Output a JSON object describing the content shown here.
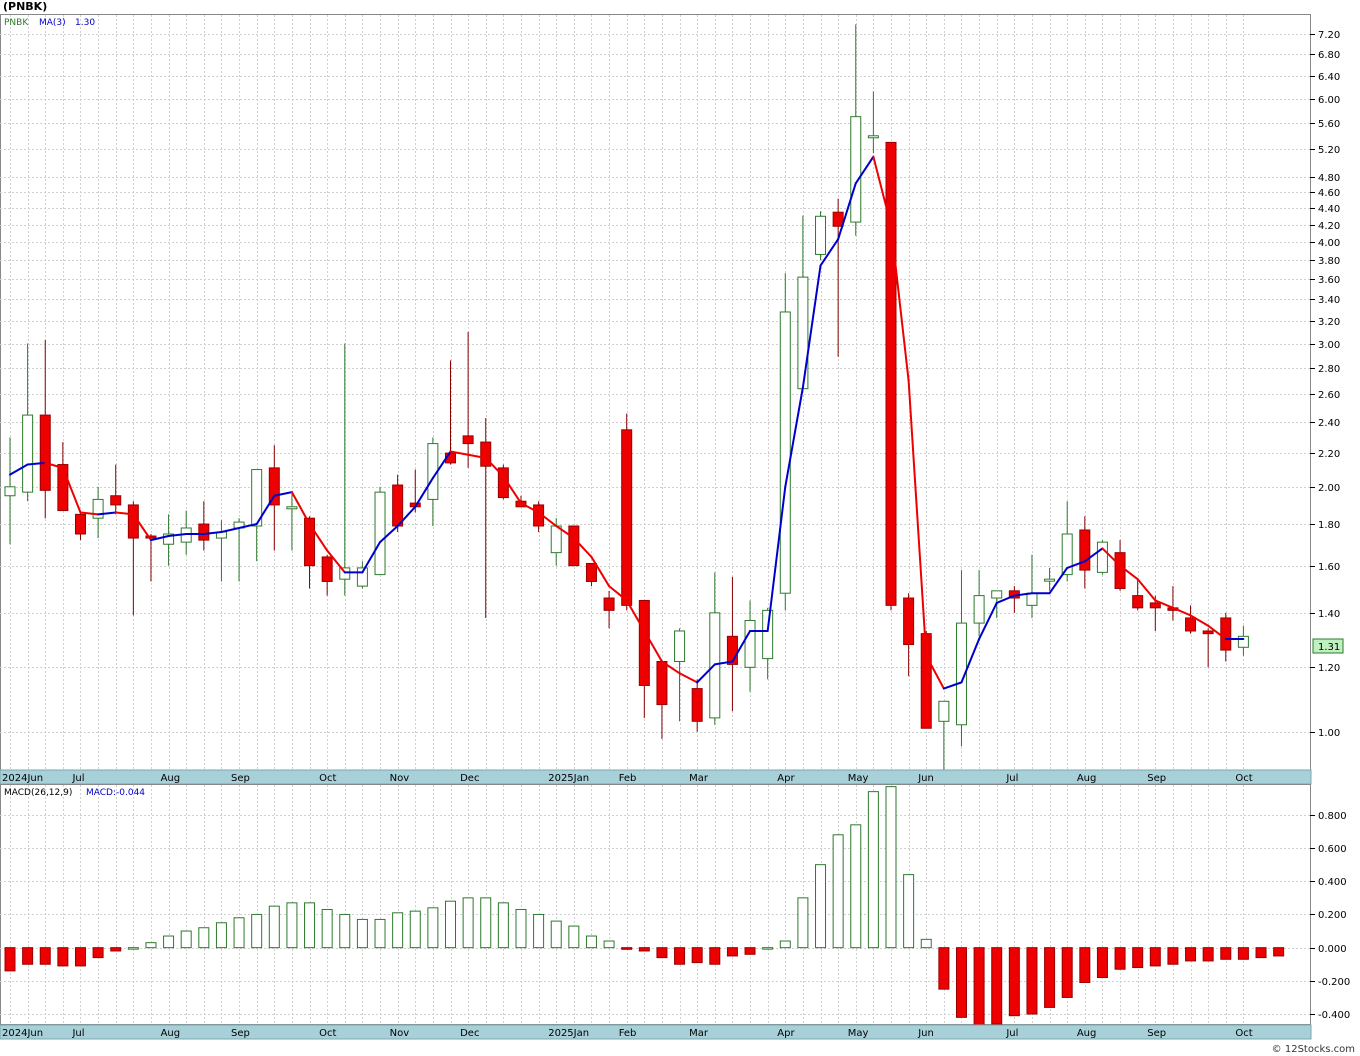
{
  "header": {
    "symbol_title": "(PNBK)",
    "legend_symbol": "PNBK",
    "legend_ma_label": "MA(3)",
    "legend_ma_value": "1.30",
    "macd_label": "MACD(26,12,9)",
    "macd_value_label": "MACD:-0.044",
    "last_price_label": "1.31",
    "footer_credit": "© 12Stocks.com"
  },
  "colors": {
    "up_candle": "#2d7a2d",
    "down_candle": "#ee0000",
    "ma_rising": "#0000cc",
    "ma_falling": "#ee0000",
    "grid": "#d0d0d0",
    "axis_band": "#a8d0d8",
    "last_price_box": "#bff0bf"
  },
  "chart_data": [
    {
      "type": "candlestick",
      "title": "(PNBK)",
      "scale": "log",
      "ylim": [
        0.9,
        7.6
      ],
      "y_ticks": [
        1.0,
        1.2,
        1.4,
        1.6,
        1.8,
        2.0,
        2.2,
        2.4,
        2.6,
        2.8,
        3.0,
        3.2,
        3.4,
        3.6,
        3.8,
        4.0,
        4.2,
        4.4,
        4.6,
        4.8,
        5.2,
        5.6,
        6.0,
        6.4,
        6.8,
        7.2
      ],
      "y_tick_labels": [
        "1.00",
        "1.20",
        "1.40",
        "1.60",
        "1.80",
        "2.00",
        "2.20",
        "2.40",
        "2.60",
        "2.80",
        "3.00",
        "3.20",
        "3.40",
        "3.60",
        "3.80",
        "4.00",
        "4.20",
        "4.40",
        "4.60",
        "4.80",
        "5.20",
        "5.60",
        "6.00",
        "6.40",
        "6.80",
        "7.20"
      ],
      "x_labels": [
        "2024Jun",
        "Jul",
        "Aug",
        "Sep",
        "Oct",
        "Nov",
        "Dec",
        "2025Jan",
        "Feb",
        "Mar",
        "Apr",
        "May",
        "Jun",
        "Jul",
        "Aug",
        "Sep",
        "Oct"
      ],
      "x_label_weeks": [
        0,
        4,
        9,
        13,
        18,
        22,
        26,
        31,
        35,
        39,
        44,
        48,
        52,
        57,
        61,
        65,
        70
      ],
      "grid": true,
      "candles": [
        {
          "o": 1.95,
          "h": 2.3,
          "l": 1.7,
          "c": 2.0
        },
        {
          "o": 1.97,
          "h": 3.0,
          "l": 1.92,
          "c": 2.45
        },
        {
          "o": 2.45,
          "h": 3.03,
          "l": 1.83,
          "c": 1.98
        },
        {
          "o": 2.13,
          "h": 2.27,
          "l": 1.87,
          "c": 1.87
        },
        {
          "o": 1.85,
          "h": 1.87,
          "l": 1.72,
          "c": 1.75
        },
        {
          "o": 1.83,
          "h": 2.0,
          "l": 1.73,
          "c": 1.93
        },
        {
          "o": 1.95,
          "h": 2.13,
          "l": 1.85,
          "c": 1.9
        },
        {
          "o": 1.9,
          "h": 1.92,
          "l": 1.39,
          "c": 1.73
        },
        {
          "o": 1.74,
          "h": 1.75,
          "l": 1.53,
          "c": 1.73
        },
        {
          "o": 1.7,
          "h": 1.85,
          "l": 1.6,
          "c": 1.75
        },
        {
          "o": 1.71,
          "h": 1.87,
          "l": 1.65,
          "c": 1.78
        },
        {
          "o": 1.8,
          "h": 1.92,
          "l": 1.67,
          "c": 1.72
        },
        {
          "o": 1.73,
          "h": 1.82,
          "l": 1.53,
          "c": 1.76
        },
        {
          "o": 1.78,
          "h": 1.83,
          "l": 1.53,
          "c": 1.81
        },
        {
          "o": 1.79,
          "h": 2.1,
          "l": 1.62,
          "c": 2.1
        },
        {
          "o": 2.11,
          "h": 2.25,
          "l": 1.67,
          "c": 1.9
        },
        {
          "o": 1.89,
          "h": 1.96,
          "l": 1.67,
          "c": 1.89
        },
        {
          "o": 1.83,
          "h": 1.84,
          "l": 1.5,
          "c": 1.6
        },
        {
          "o": 1.64,
          "h": 1.65,
          "l": 1.47,
          "c": 1.53
        },
        {
          "o": 1.54,
          "h": 3.0,
          "l": 1.47,
          "c": 1.59
        },
        {
          "o": 1.51,
          "h": 1.62,
          "l": 1.5,
          "c": 1.59
        },
        {
          "o": 1.56,
          "h": 2.0,
          "l": 1.56,
          "c": 1.97
        },
        {
          "o": 2.01,
          "h": 2.07,
          "l": 1.76,
          "c": 1.79
        },
        {
          "o": 1.91,
          "h": 2.1,
          "l": 1.86,
          "c": 1.89
        },
        {
          "o": 1.93,
          "h": 2.3,
          "l": 1.79,
          "c": 2.26
        },
        {
          "o": 2.2,
          "h": 2.86,
          "l": 2.13,
          "c": 2.14
        },
        {
          "o": 2.31,
          "h": 3.1,
          "l": 2.11,
          "c": 2.26
        },
        {
          "o": 2.27,
          "h": 2.43,
          "l": 1.38,
          "c": 2.12
        },
        {
          "o": 2.11,
          "h": 2.13,
          "l": 1.93,
          "c": 1.94
        },
        {
          "o": 1.92,
          "h": 1.95,
          "l": 1.91,
          "c": 1.89
        },
        {
          "o": 1.9,
          "h": 1.92,
          "l": 1.76,
          "c": 1.79
        },
        {
          "o": 1.66,
          "h": 1.83,
          "l": 1.6,
          "c": 1.79
        },
        {
          "o": 1.79,
          "h": 1.79,
          "l": 1.6,
          "c": 1.6
        },
        {
          "o": 1.61,
          "h": 1.61,
          "l": 1.51,
          "c": 1.53
        },
        {
          "o": 1.46,
          "h": 1.49,
          "l": 1.34,
          "c": 1.41
        },
        {
          "o": 2.35,
          "h": 2.46,
          "l": 1.41,
          "c": 1.43
        },
        {
          "o": 1.45,
          "h": 1.45,
          "l": 1.04,
          "c": 1.14
        },
        {
          "o": 1.22,
          "h": 1.22,
          "l": 0.98,
          "c": 1.08
        },
        {
          "o": 1.22,
          "h": 1.34,
          "l": 1.03,
          "c": 1.33
        },
        {
          "o": 1.13,
          "h": 1.16,
          "l": 1.0,
          "c": 1.03
        },
        {
          "o": 1.04,
          "h": 1.57,
          "l": 1.02,
          "c": 1.4
        },
        {
          "o": 1.31,
          "h": 1.55,
          "l": 1.06,
          "c": 1.21
        },
        {
          "o": 1.2,
          "h": 1.45,
          "l": 1.12,
          "c": 1.37
        },
        {
          "o": 1.23,
          "h": 1.42,
          "l": 1.16,
          "c": 1.41
        },
        {
          "o": 1.48,
          "h": 3.66,
          "l": 1.41,
          "c": 3.28
        },
        {
          "o": 2.64,
          "h": 4.31,
          "l": 2.64,
          "c": 3.62
        },
        {
          "o": 3.86,
          "h": 4.36,
          "l": 3.8,
          "c": 4.3
        },
        {
          "o": 4.35,
          "h": 4.52,
          "l": 2.89,
          "c": 4.18
        },
        {
          "o": 4.23,
          "h": 7.4,
          "l": 4.07,
          "c": 5.7
        },
        {
          "o": 5.4,
          "h": 6.12,
          "l": 5.14,
          "c": 5.4
        },
        {
          "o": 5.3,
          "h": 5.3,
          "l": 1.41,
          "c": 1.43
        },
        {
          "o": 1.46,
          "h": 1.48,
          "l": 1.17,
          "c": 1.28
        },
        {
          "o": 1.32,
          "h": 1.33,
          "l": 1.01,
          "c": 1.01
        },
        {
          "o": 1.03,
          "h": 1.08,
          "l": 0.89,
          "c": 1.09
        },
        {
          "o": 1.02,
          "h": 1.58,
          "l": 0.96,
          "c": 1.36
        },
        {
          "o": 1.36,
          "h": 1.58,
          "l": 1.31,
          "c": 1.47
        },
        {
          "o": 1.46,
          "h": 1.49,
          "l": 1.38,
          "c": 1.49
        },
        {
          "o": 1.49,
          "h": 1.51,
          "l": 1.4,
          "c": 1.46
        },
        {
          "o": 1.43,
          "h": 1.65,
          "l": 1.38,
          "c": 1.48
        },
        {
          "o": 1.54,
          "h": 1.59,
          "l": 1.49,
          "c": 1.54
        },
        {
          "o": 1.56,
          "h": 1.92,
          "l": 1.53,
          "c": 1.75
        },
        {
          "o": 1.77,
          "h": 1.84,
          "l": 1.5,
          "c": 1.58
        },
        {
          "o": 1.57,
          "h": 1.72,
          "l": 1.56,
          "c": 1.71
        },
        {
          "o": 1.66,
          "h": 1.72,
          "l": 1.49,
          "c": 1.5
        },
        {
          "o": 1.47,
          "h": 1.54,
          "l": 1.41,
          "c": 1.42
        },
        {
          "o": 1.44,
          "h": 1.47,
          "l": 1.33,
          "c": 1.42
        },
        {
          "o": 1.42,
          "h": 1.51,
          "l": 1.37,
          "c": 1.41
        },
        {
          "o": 1.38,
          "h": 1.43,
          "l": 1.32,
          "c": 1.33
        },
        {
          "o": 1.33,
          "h": 1.34,
          "l": 1.2,
          "c": 1.32
        },
        {
          "o": 1.38,
          "h": 1.4,
          "l": 1.22,
          "c": 1.26
        },
        {
          "o": 1.27,
          "h": 1.35,
          "l": 1.24,
          "c": 1.31
        }
      ],
      "ma3": [
        2.07,
        2.13,
        2.14,
        2.11,
        1.86,
        1.85,
        1.86,
        1.85,
        1.72,
        1.74,
        1.75,
        1.75,
        1.76,
        1.78,
        1.8,
        1.95,
        1.97,
        1.8,
        1.67,
        1.57,
        1.57,
        1.71,
        1.79,
        1.89,
        2.05,
        2.21,
        2.19,
        2.17,
        2.06,
        1.91,
        1.86,
        1.79,
        1.73,
        1.64,
        1.51,
        1.45,
        1.33,
        1.22,
        1.18,
        1.15,
        1.21,
        1.22,
        1.33,
        1.33,
        2.0,
        2.65,
        3.74,
        4.03,
        4.72,
        5.09,
        4.19,
        2.7,
        1.24,
        1.13,
        1.15,
        1.3,
        1.44,
        1.47,
        1.48,
        1.48,
        1.59,
        1.62,
        1.68,
        1.6,
        1.54,
        1.45,
        1.42,
        1.39,
        1.35,
        1.3,
        1.3
      ],
      "last_price": 1.31
    },
    {
      "type": "bar",
      "title": "MACD(26,12,9)",
      "ylim": [
        -0.46,
        0.98
      ],
      "y_ticks": [
        -0.4,
        -0.2,
        0.0,
        0.2,
        0.4,
        0.6,
        0.8
      ],
      "y_tick_labels": [
        "-0.400",
        "-0.200",
        "0.000",
        "0.200",
        "0.400",
        "0.600",
        "0.800"
      ],
      "x_labels": [
        "2024Jun",
        "Jul",
        "Aug",
        "Sep",
        "Oct",
        "Nov",
        "Dec",
        "2025Jan",
        "Feb",
        "Mar",
        "Apr",
        "May",
        "Jun",
        "Jul",
        "Aug",
        "Sep",
        "Oct"
      ],
      "values": [
        -0.14,
        -0.1,
        -0.1,
        -0.11,
        -0.11,
        -0.06,
        -0.02,
        0.0,
        0.03,
        0.07,
        0.1,
        0.12,
        0.15,
        0.18,
        0.2,
        0.25,
        0.27,
        0.27,
        0.23,
        0.2,
        0.17,
        0.17,
        0.21,
        0.22,
        0.24,
        0.28,
        0.3,
        0.3,
        0.27,
        0.23,
        0.2,
        0.16,
        0.13,
        0.07,
        0.04,
        -0.01,
        -0.02,
        -0.06,
        -0.1,
        -0.09,
        -0.1,
        -0.05,
        -0.04,
        0.0,
        0.04,
        0.3,
        0.5,
        0.68,
        0.74,
        0.94,
        0.97,
        0.44,
        0.05,
        -0.25,
        -0.42,
        -0.47,
        -0.46,
        -0.41,
        -0.4,
        -0.36,
        -0.3,
        -0.21,
        -0.18,
        -0.13,
        -0.12,
        -0.11,
        -0.1,
        -0.08,
        -0.08,
        -0.07,
        -0.07,
        -0.06,
        -0.05
      ],
      "last_value": -0.044
    }
  ]
}
